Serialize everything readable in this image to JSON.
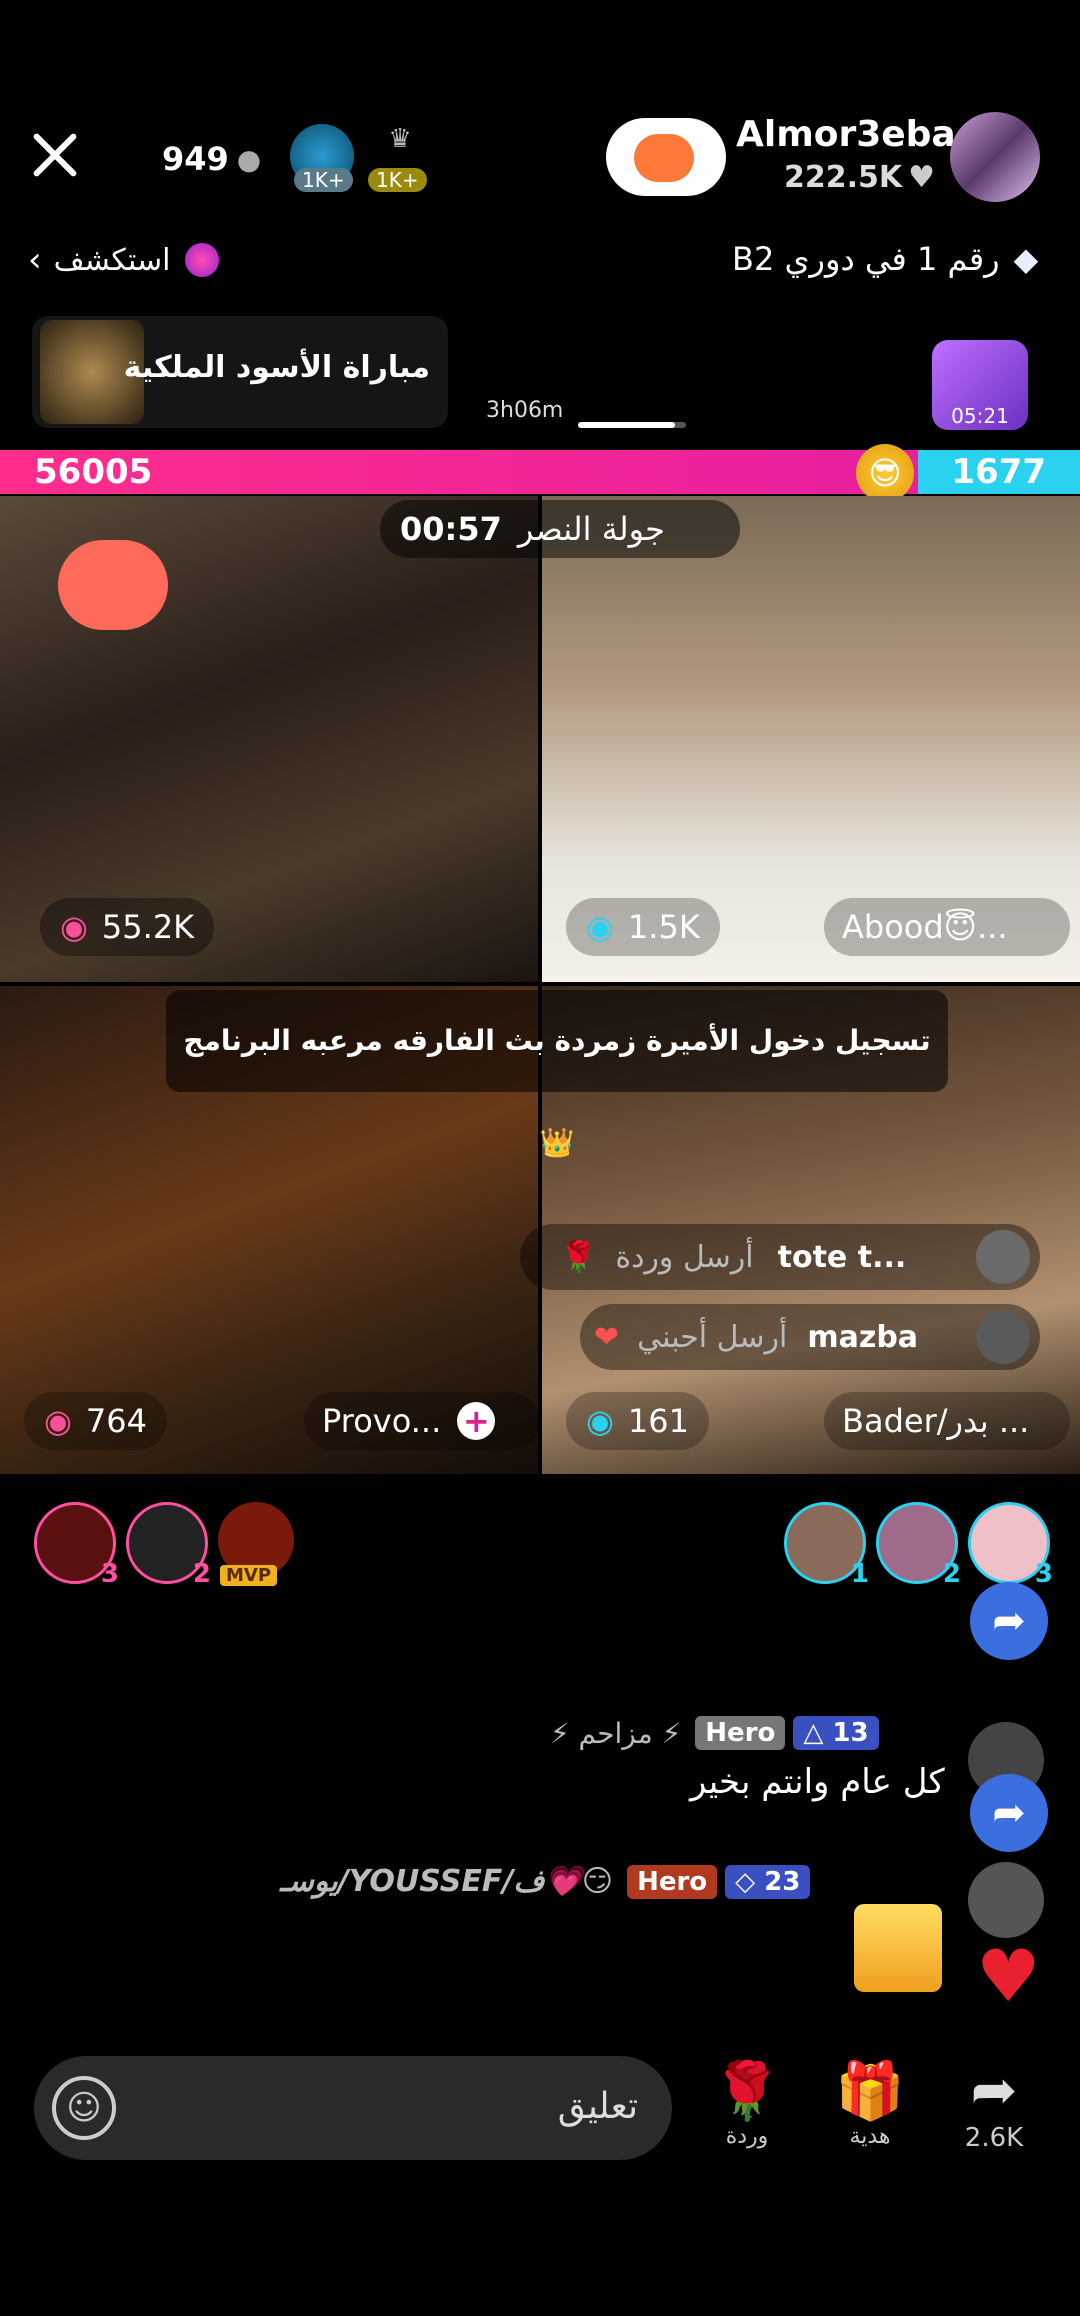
{
  "header": {
    "viewer_count": "949",
    "top_gifter_badges": [
      "1K+",
      "1K+"
    ],
    "host_name": "Almor3eba",
    "host_likes": "222.5K",
    "explore_label": "استكشف",
    "league_label": "رقم 1 في دوري B2"
  },
  "event": {
    "title": "مباراة الأسود الملكية",
    "timer": "3h06m",
    "gift_timer": "05:21"
  },
  "battle": {
    "left_score": "56005",
    "right_score": "1677",
    "round_label": "جولة النصر",
    "round_timer": "00:57",
    "left_progress": 0.85
  },
  "tiles": [
    {
      "score": "55.2K",
      "name": ""
    },
    {
      "score": "1.5K",
      "name": "Abood😇..."
    },
    {
      "score": "764",
      "name": "Provo..."
    },
    {
      "score": "161",
      "name": "Bader/بدر ..."
    }
  ],
  "banner": "تسجيل دخول الأميرة زمردة بث الفارقه مرعبه البرنامج 👑",
  "gift_feed": [
    {
      "user": "tote t...",
      "action": "أرسل وردة",
      "gift": "🌹"
    },
    {
      "user": "mazba",
      "action": "أرسل أحبني",
      "gift": "❤️"
    }
  ],
  "left_rankers": [
    "3",
    "2",
    "MVP"
  ],
  "right_rankers": [
    "1",
    "2",
    "3"
  ],
  "comments": [
    {
      "level": "13",
      "tag": "Hero",
      "name": "⚡ مزاحم ⚡",
      "text": "كل عام وانتم بخير"
    },
    {
      "level": "23",
      "tag": "Hero",
      "name": "😏💗ف/YOUSSEF/يوسـ",
      "text": ""
    }
  ],
  "bottom": {
    "comment_placeholder": "تعليق",
    "rose_label": "وردة",
    "gift_label": "هدية",
    "share_count": "2.6K"
  },
  "colors": {
    "accent_pink": "#ff2d8c",
    "accent_cyan": "#2ad2f0",
    "blue_share": "#3b6fe0"
  }
}
